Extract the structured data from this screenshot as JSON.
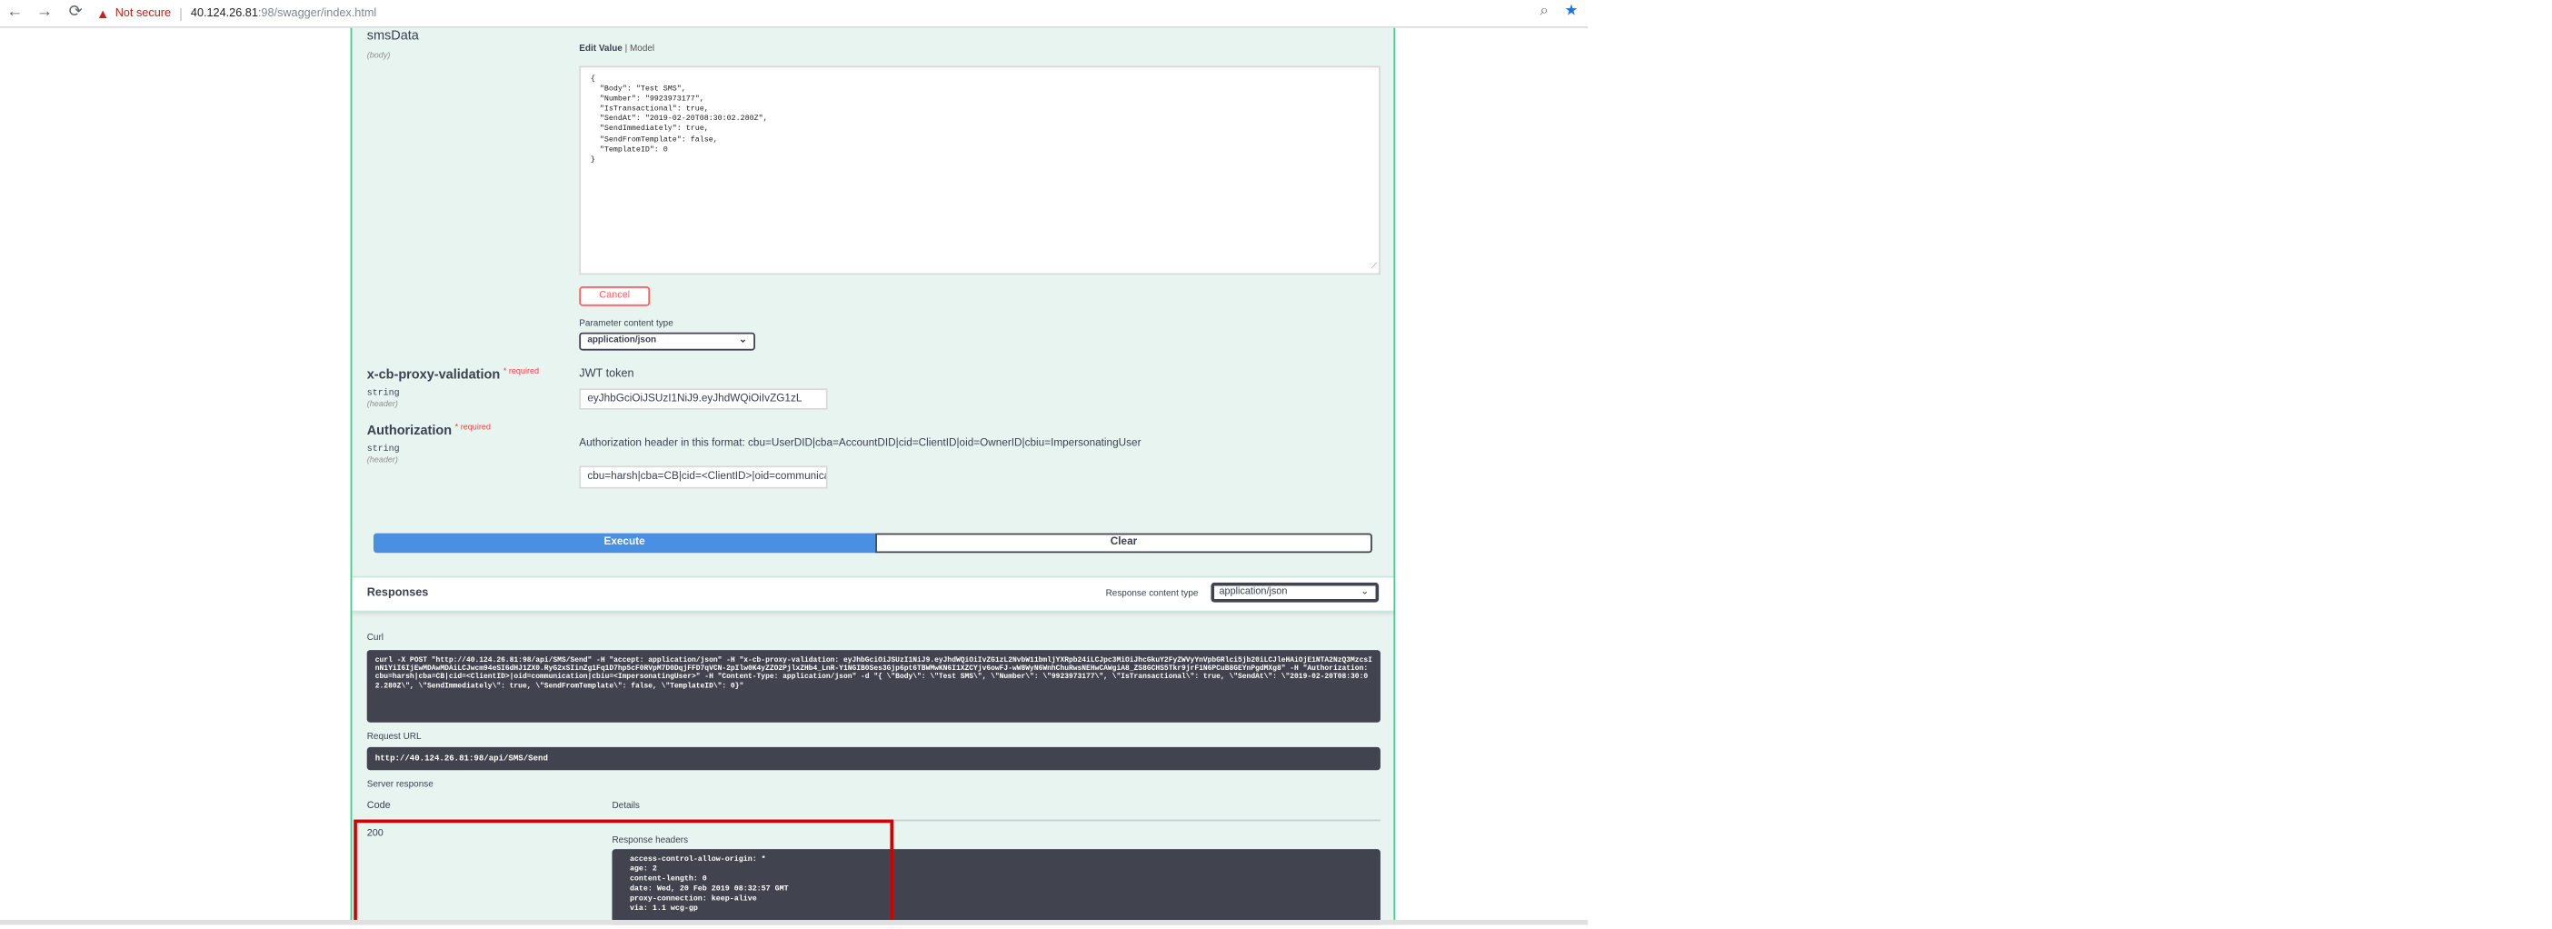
{
  "browser": {
    "warning_icon": "warning-triangle-icon",
    "not_secure": "Not secure",
    "separator": "|",
    "host": "40.124.26.81",
    "path": ":98/swagger/index.html",
    "back_glyph": "←",
    "forward_glyph": "→",
    "reload_glyph": "⟳",
    "zoom_glyph": "⌕",
    "star_glyph": "★"
  },
  "params": {
    "body_name": "smsData",
    "body_in": "(body)",
    "edit_value": "Edit Value",
    "model": "| Model",
    "body_lines": [
      "{",
      "  \"Body\": \"Test SMS\",",
      "  \"Number\": \"9923973177\",",
      "  \"IsTransactional\": true,",
      "  \"SendAt\": \"2019-02-20T08:30:02.280Z\",",
      "  \"SendImmediately\": true,",
      "  \"SendFromTemplate\": false,",
      "  \"TemplateID\": 0",
      "}"
    ],
    "cancel": "Cancel",
    "param_content_type_label": "Parameter content type",
    "param_content_type": "application/json",
    "proxy_name": "x-cb-proxy-validation",
    "proxy_type": "string",
    "proxy_in": "(header)",
    "required": "* required",
    "jwt_label": "JWT token",
    "jwt_value": "eyJhbGciOiJSUzI1NiJ9.eyJhdWQiOiIvZG1zL",
    "auth_name": "Authorization",
    "auth_type": "string",
    "auth_in": "(header)",
    "auth_desc": "Authorization header in this format: cbu=UserDID|cba=AccountDID|cid=ClientID|oid=OwnerID|cbiu=ImpersonatingUser",
    "auth_value": "cbu=harsh|cba=CB|cid=<ClientID>|oid=communication"
  },
  "actions": {
    "execute": "Execute",
    "clear": "Clear"
  },
  "responses": {
    "title": "Responses",
    "content_type_label": "Response content type",
    "content_type": "application/json",
    "curl_label": "Curl",
    "curl": "curl -X POST \"http://40.124.26.81:98/api/SMS/Send\" -H \"accept: application/json\" -H \"x-cb-proxy-validation: eyJhbGciOiJSUzI1NiJ9.eyJhdWQiOiIvZG1zL2NvbW11bmljYXRpb24iLCJpc3MiOiJhcGkuY2FyZWVyYnVpbGRlci5jb20iLCJleHAiOjE1NTA2NzQ3MzcsInN1YiI6IjEwMDAwMDAiLCJwcm94eSI6dHJ1ZX0.RyG2xSIinZg1Fq1D7hp5cF0RVpM7D0DqjFFD7qVCN-2pIlw0K4yZZO2PjlxZHb4_LnR-Y1NGIB0Ses3Gjp6pt6TBWMwKN6I1XZCYjv6owFJ-wW8WyN6WnhChuRwsNEHwCAWgiA8_ZS8GCHS5Tkr9jrF1N6PCuB8GEYnPgdMXg8\" -H \"Authorization: cbu=harsh|cba=CB|cid=<ClientID>|oid=communication|cbiu=<ImpersonatingUser>\" -H \"Content-Type: application/json\" -d \"{ \\\"Body\\\": \\\"Test SMS\\\", \\\"Number\\\": \\\"9923973177\\\", \\\"IsTransactional\\\": true, \\\"SendAt\\\": \\\"2019-02-20T08:30:02.280Z\\\", \\\"SendImmediately\\\": true, \\\"SendFromTemplate\\\": false, \\\"TemplateID\\\": 0}\"",
    "request_url_label": "Request URL",
    "request_url": "http://40.124.26.81:98/api/SMS/Send",
    "server_response_label": "Server response",
    "code_header": "Code",
    "details_header": "Details",
    "code": "200",
    "response_headers_label": "Response headers",
    "headers": [
      " access-control-allow-origin: * ",
      " age: 2 ",
      " content-length: 0 ",
      " date: Wed, 20 Feb 2019 08:32:57 GMT ",
      " proxy-connection: keep-alive ",
      " via: 1.1 wcg-gp "
    ]
  },
  "colors": {
    "post_bg": "#e8f4f0",
    "post_border": "#49cc90",
    "execute": "#4990e2",
    "highlight": "#d40000",
    "code_bg": "#41444e"
  }
}
